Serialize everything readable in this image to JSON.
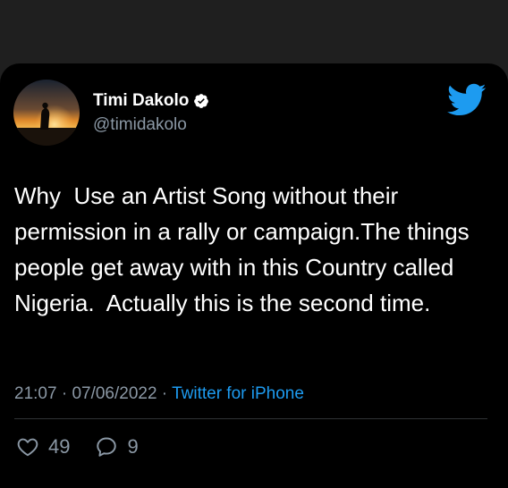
{
  "tweet": {
    "author_name": "Timi Dakolo",
    "author_handle": "@timidakolo",
    "verified": true,
    "text": "Why  Use an Artist Song without their permission in a rally or campaign.The things people get away with in this Country called Nigeria.  Actually this is the second time.",
    "time": "21:07",
    "date": "07/06/2022",
    "source": "Twitter for iPhone",
    "likes": "49",
    "replies": "9"
  },
  "icons": {
    "brand": "twitter-bird-icon",
    "verified": "verified-badge-icon",
    "like": "heart-icon",
    "reply": "comment-icon"
  },
  "colors": {
    "background": "#000000",
    "surround": "#1f1f1f",
    "text": "#ffffff",
    "muted": "#8b98a5",
    "accent": "#1d9bf0"
  }
}
